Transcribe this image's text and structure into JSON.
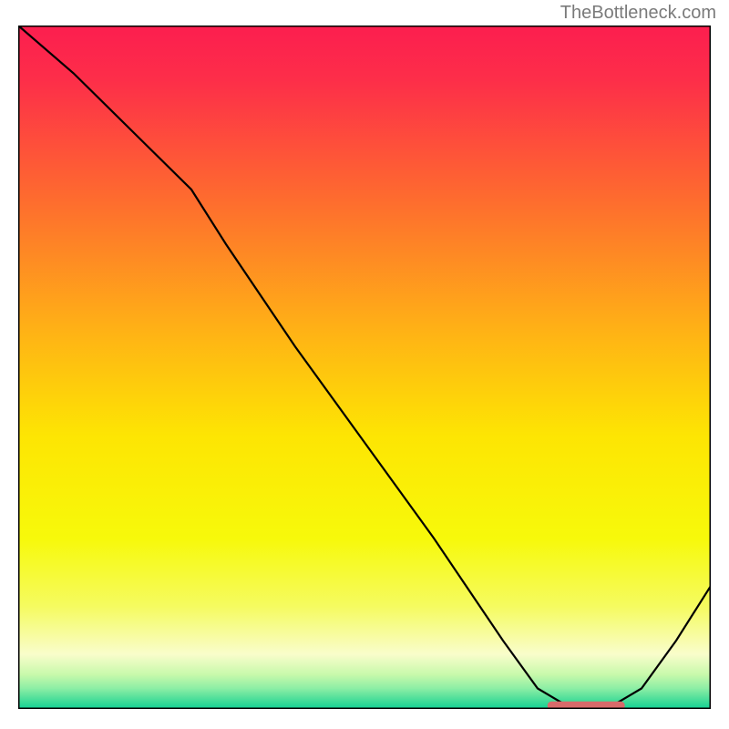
{
  "attribution": "TheBottleneck.com",
  "chart_data": {
    "type": "line",
    "title": "",
    "xlabel": "",
    "ylabel": "",
    "xlim": [
      0,
      100
    ],
    "ylim": [
      0,
      100
    ],
    "background_gradient": {
      "stops": [
        {
          "offset": 0.0,
          "color": "#fc1e4f"
        },
        {
          "offset": 0.08,
          "color": "#fd2e49"
        },
        {
          "offset": 0.25,
          "color": "#fe6a2f"
        },
        {
          "offset": 0.45,
          "color": "#ffb315"
        },
        {
          "offset": 0.6,
          "color": "#fde503"
        },
        {
          "offset": 0.75,
          "color": "#f7f90a"
        },
        {
          "offset": 0.85,
          "color": "#f5fb60"
        },
        {
          "offset": 0.92,
          "color": "#f9fdcb"
        },
        {
          "offset": 0.95,
          "color": "#c7f9ab"
        },
        {
          "offset": 0.97,
          "color": "#8ceea5"
        },
        {
          "offset": 0.99,
          "color": "#3ada97"
        },
        {
          "offset": 1.0,
          "color": "#11d194"
        }
      ]
    },
    "series": [
      {
        "name": "bottleneck-curve",
        "type": "line",
        "color": "#000000",
        "x": [
          0,
          8,
          18,
          25,
          30,
          40,
          50,
          60,
          70,
          75,
          80,
          85,
          90,
          95,
          100
        ],
        "y": [
          100,
          93,
          83,
          76,
          68,
          53,
          39,
          25,
          10,
          3,
          0,
          0,
          3,
          10,
          18
        ]
      }
    ],
    "marker_segment": {
      "name": "optimal-range",
      "color": "#d86a6a",
      "x_start": 77,
      "x_end": 87,
      "y": 0.5,
      "thickness": 1.2
    },
    "axes": {
      "frame_color": "#000000",
      "frame_width": 3
    }
  }
}
